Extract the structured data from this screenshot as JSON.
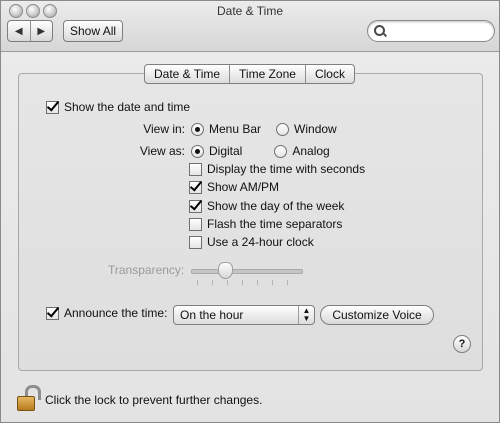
{
  "window": {
    "title": "Date & Time"
  },
  "toolbar": {
    "back_glyph": "◀",
    "forward_glyph": "▶",
    "show_all_label": "Show All",
    "search_value": ""
  },
  "tabs": [
    {
      "label": "Date & Time",
      "selected": false
    },
    {
      "label": "Time Zone",
      "selected": false
    },
    {
      "label": "Clock",
      "selected": true
    }
  ],
  "clock": {
    "show_date_time": {
      "label": "Show the date and time",
      "checked": true
    },
    "view_in": {
      "label": "View in:",
      "options": [
        {
          "label": "Menu Bar",
          "selected": true
        },
        {
          "label": "Window",
          "selected": false
        }
      ]
    },
    "view_as": {
      "label": "View as:",
      "options": [
        {
          "label": "Digital",
          "selected": true
        },
        {
          "label": "Analog",
          "selected": false
        }
      ]
    },
    "options": [
      {
        "label": "Display the time with seconds",
        "checked": false
      },
      {
        "label": "Show AM/PM",
        "checked": true
      },
      {
        "label": "Show the day of the week",
        "checked": true
      },
      {
        "label": "Flash the time separators",
        "checked": false
      },
      {
        "label": "Use a 24-hour clock",
        "checked": false
      }
    ],
    "transparency": {
      "label": "Transparency:",
      "value_fraction": 0.3,
      "enabled": false
    },
    "announce": {
      "label": "Announce the time:",
      "checked": true,
      "interval": "On the hour",
      "customize_label": "Customize Voice"
    }
  },
  "help_label": "?",
  "lock_text": "Click the lock to prevent further changes."
}
